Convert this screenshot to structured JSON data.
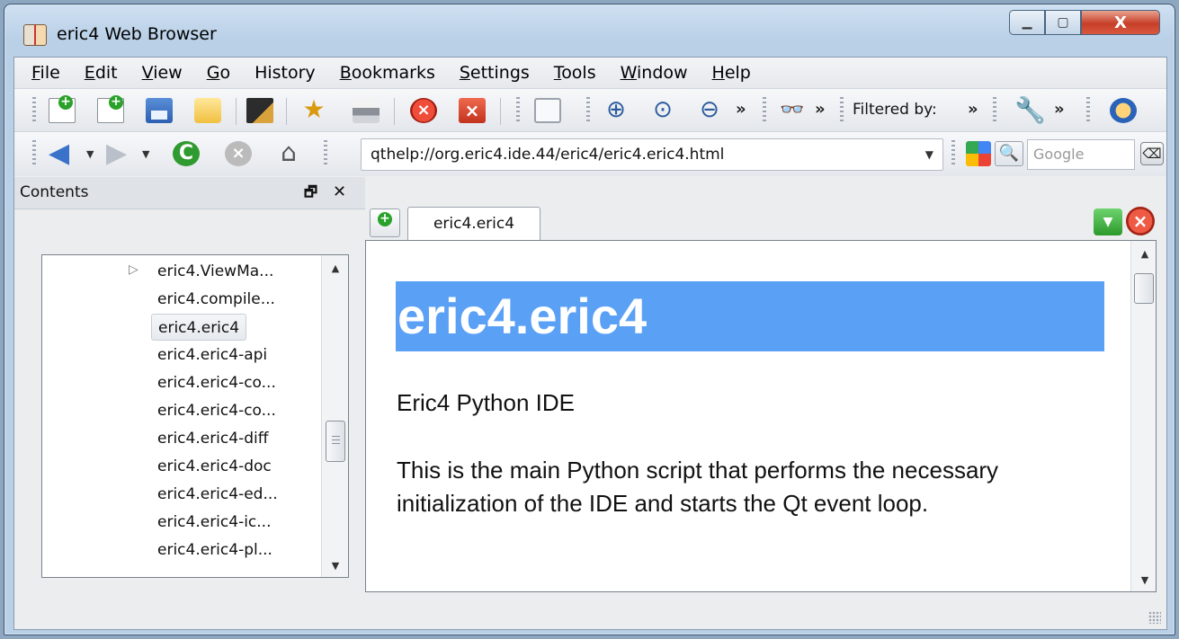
{
  "window": {
    "title": "eric4 Web Browser",
    "controls": {
      "minimize": "▁",
      "maximize": "▢",
      "close": "X"
    }
  },
  "menubar": {
    "items": [
      "File",
      "Edit",
      "View",
      "Go",
      "History",
      "Bookmarks",
      "Settings",
      "Tools",
      "Window",
      "Help"
    ]
  },
  "toolbar": {
    "icons": [
      "new-tab-icon",
      "new-window-icon",
      "save-icon",
      "open-file-icon",
      "edit-icon",
      "bookmark-star-icon",
      "print-icon",
      "stop-icon",
      "close-icon",
      "copy-icon",
      "zoom-in-icon",
      "zoom-reset-icon",
      "zoom-out-icon",
      "find-icon",
      "tools-icon",
      "whats-this-icon"
    ],
    "overflow": "»",
    "filtered_by_label": "Filtered by:"
  },
  "navbar": {
    "url": "qthelp://org.eric4.ide.44/eric4/eric4.eric4.html",
    "search_placeholder": "Google",
    "search_engine": "google-icon"
  },
  "dock": {
    "title": "Contents",
    "float_glyph": "🗗",
    "close_glyph": "✕",
    "items": [
      "eric4.ViewMa...",
      "eric4.compile...",
      "eric4.eric4",
      "eric4.eric4-api",
      "eric4.eric4-co...",
      "eric4.eric4-co...",
      "eric4.eric4-diff",
      "eric4.eric4-doc",
      "eric4.eric4-ed...",
      "eric4.eric4-ic...",
      "eric4.eric4-pl..."
    ],
    "selected": "eric4.eric4"
  },
  "tabs": {
    "items": [
      "eric4.eric4"
    ]
  },
  "page": {
    "heading": "eric4.eric4",
    "subtitle": "Eric4 Python IDE",
    "paragraph": "This is the main Python script that performs the necessary initialization of the IDE and starts the Qt event loop."
  },
  "colors": {
    "heading_bg": "#5aa0f5",
    "close_red": "#c73e28"
  }
}
